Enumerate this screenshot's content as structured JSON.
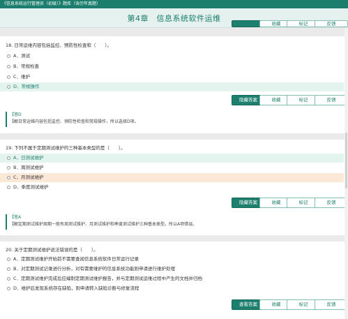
{
  "header": {
    "breadcrumb": "《信息系统运行管理员（初级）》题库（含历年真题）",
    "chapter_title": "第4章　信息系统软件运维"
  },
  "top_buttons": {
    "b1": "",
    "b2": "收藏",
    "b3": "标记",
    "b4": "反馈"
  },
  "questions": [
    {
      "title": "18. 日常运维内容包括监控、预防性检查和（　　）。",
      "options": [
        "A．测试",
        "B．常规检查",
        "C．维护",
        "D．常规操作"
      ],
      "buttons": {
        "primary": "隐藏答案",
        "fav": "收藏",
        "mark": "标记",
        "feedback": "反馈"
      },
      "answer_label": "【答D",
      "explanation": "【解日常运维内容包括监控、预防性检查和常规操作，所以选择D项。"
    },
    {
      "title": "19. 下列不属于定期测试维护的三种基本类型的是（　　）。",
      "options": [
        "A．日测试维护",
        "B．周测试维护",
        "C．月测试维护",
        "D．季度测试维护"
      ],
      "buttons": {
        "primary": "隐藏答案",
        "fav": "收藏",
        "mark": "标记",
        "feedback": "反馈"
      },
      "answer_label": "【答A",
      "explanation": "【解定期测试维护周期一般有周测试维护、月测试维护和季度测试维护三种基本类型。所以A项错误。"
    },
    {
      "title": "20. 关于定期测试维护说法错误的是（　　）。",
      "options": [
        "A．定期测试维护开始前不需要查阅信息系统软件日常运行记录",
        "B．对定期测试记录进行分析，对有需要维护的信息系统功能则申请进行维护处理",
        "C．定期测试维护完成后应编制定期测试维护报告，并与定期测试运维过程中产生的文档并归档",
        "D．维护后发现系统存在缺陷，则申请转入缺陷诊断与修复流程"
      ],
      "buttons": {
        "primary": "查看答案",
        "fav": "收藏",
        "mark": "标记",
        "feedback": "反馈"
      }
    }
  ],
  "colors": {
    "brand": "#1b7d6c",
    "correct_bg": "#e3f3ee",
    "wrong_bg": "#fce8d6"
  }
}
